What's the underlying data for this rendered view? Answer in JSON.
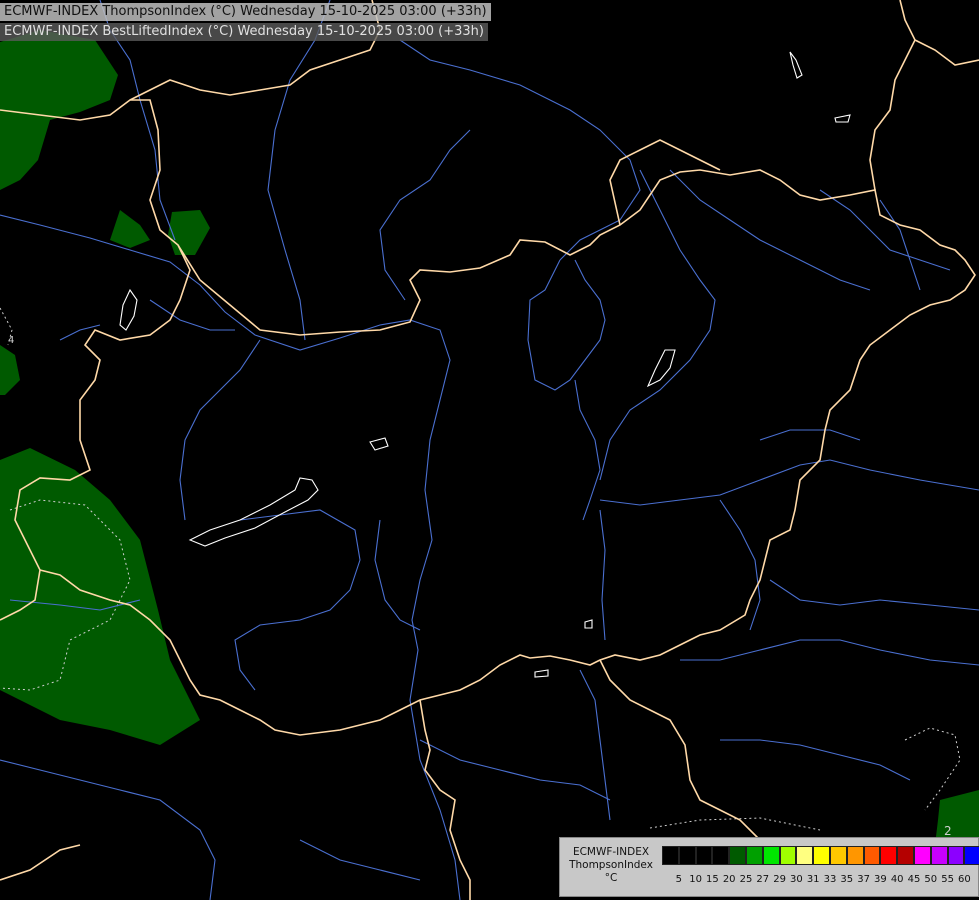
{
  "header": {
    "line1": "ECMWF-INDEX ThompsonIndex (°C) Wednesday 15-10-2025 03:00 (+33h)",
    "line2": "ECMWF-INDEX BestLiftedIndex (°C) Wednesday 15-10-2025 03:00 (+33h)"
  },
  "legend": {
    "model": "ECMWF-INDEX",
    "parameter": "ThompsonIndex",
    "unit": "°C",
    "ticks": [
      "5",
      "10",
      "15",
      "20",
      "25",
      "27",
      "29",
      "30",
      "31",
      "33",
      "35",
      "37",
      "39",
      "40",
      "45",
      "50",
      "55",
      "60"
    ],
    "colors": [
      "#000000",
      "#000000",
      "#000000",
      "#000000",
      "#005a00",
      "#00a000",
      "#00e600",
      "#a0ff00",
      "#ffff80",
      "#ffff00",
      "#ffc800",
      "#ff9600",
      "#ff5a00",
      "#ff0000",
      "#b40000",
      "#ff00ff",
      "#c800ff",
      "#8c00ff",
      "#0000ff"
    ]
  },
  "map_labels": {
    "contour_label_left": "4",
    "contour_label_right": "2"
  },
  "colors": {
    "background": "#000000",
    "border": "#ffd9a8",
    "river": "#4a6fd0",
    "lake": "#ffffff",
    "fill_25": "#005a00"
  }
}
